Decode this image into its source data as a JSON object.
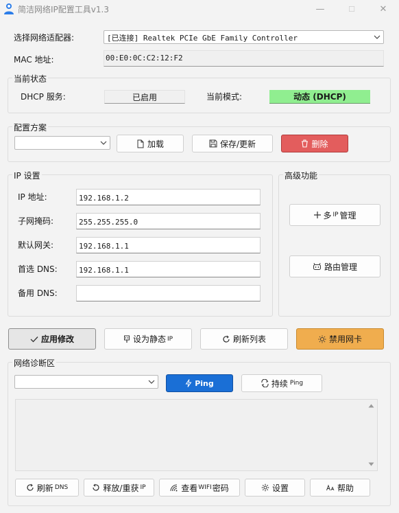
{
  "window": {
    "title": "简洁网络IP配置工具v1.3",
    "minimize": "—",
    "maximize": "☐",
    "close": "✕"
  },
  "adapter": {
    "label": "选择网络适配器:",
    "selected": "[已连接] Realtek PCIe GbE Family Controller",
    "mac_label": "MAC 地址:",
    "mac_value": "00:E0:0C:C2:12:F2"
  },
  "status": {
    "group_title": "当前状态",
    "dhcp_label": "DHCP 服务:",
    "dhcp_value": "已启用",
    "mode_label": "当前模式:",
    "mode_value": "动态 (DHCP)",
    "mode_color": "#90ee90"
  },
  "profile": {
    "group_title": "配置方案",
    "selected": "",
    "load_label": "加载",
    "save_label": "保存/更新",
    "delete_label": "删除",
    "delete_color": "#e35d5d"
  },
  "ip": {
    "group_title": "IP 设置",
    "fields": [
      {
        "label": "IP 地址:",
        "value": "192.168.1.2"
      },
      {
        "label": "子网掩码:",
        "value": "255.255.255.0"
      },
      {
        "label": "默认网关:",
        "value": "192.168.1.1"
      },
      {
        "label": "首选 DNS:",
        "value": "192.168.1.1"
      },
      {
        "label": "备用 DNS:",
        "value": ""
      }
    ]
  },
  "advanced": {
    "group_title": "高级功能",
    "multi_ip_prefix": "多",
    "multi_ip_small": "IP",
    "multi_ip_suffix": "管理",
    "route_label": "路由管理"
  },
  "actions": {
    "apply_label": "应用修改",
    "static_label": "设为静态",
    "static_small": "IP",
    "refresh_label": "刷新列表",
    "disable_label": "禁用网卡",
    "disable_color": "#f0ad4e"
  },
  "diag": {
    "group_title": "网络诊断区",
    "target": "",
    "ping_label": "Ping",
    "ping_color": "#1a6fd6",
    "continuous_label": "持续",
    "continuous_small": "Ping",
    "output": "",
    "bottom": {
      "refresh_dns": "刷新",
      "refresh_dns_small": "DNS",
      "release_renew": "释放/重获",
      "release_renew_small": "IP",
      "wifi_prefix": "查看",
      "wifi_small": "WIFI",
      "wifi_suffix": "密码",
      "settings": "设置",
      "help": "帮助"
    }
  }
}
